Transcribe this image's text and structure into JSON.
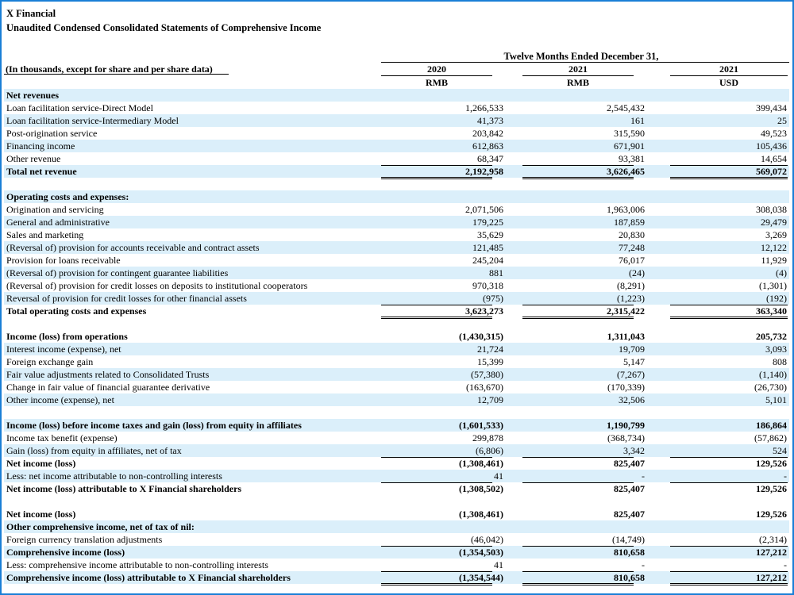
{
  "company": "X Financial",
  "statement_title": "Unaudited Condensed Consolidated Statements of Comprehensive Income",
  "period_header": "Twelve Months Ended December 31,",
  "units_note": "(In thousands, except for share and per share data)",
  "columns": [
    {
      "year": "2020",
      "currency": "RMB"
    },
    {
      "year": "2021",
      "currency": "RMB"
    },
    {
      "year": "2021",
      "currency": "USD"
    }
  ],
  "rows": [
    {
      "label": "Net revenues",
      "bold": true,
      "values": [
        "",
        "",
        ""
      ]
    },
    {
      "label": "Loan facilitation service-Direct Model",
      "values": [
        "1,266,533",
        "2,545,432",
        "399,434"
      ]
    },
    {
      "label": "Loan facilitation service-Intermediary Model",
      "values": [
        "41,373",
        "161",
        "25"
      ]
    },
    {
      "label": "Post-origination service",
      "values": [
        "203,842",
        "315,590",
        "49,523"
      ]
    },
    {
      "label": "Financing income",
      "values": [
        "612,863",
        "671,901",
        "105,436"
      ]
    },
    {
      "label": "Other revenue",
      "values": [
        "68,347",
        "93,381",
        "14,654"
      ]
    },
    {
      "label": "Total net revenue",
      "bold": true,
      "values": [
        "2,192,958",
        "3,626,465",
        "569,072"
      ]
    },
    {
      "label": "",
      "values": [
        "",
        "",
        ""
      ]
    },
    {
      "label": "Operating costs and expenses:",
      "bold": true,
      "values": [
        "",
        "",
        ""
      ]
    },
    {
      "label": "Origination and servicing",
      "values": [
        "2,071,506",
        "1,963,006",
        "308,038"
      ]
    },
    {
      "label": "General and administrative",
      "values": [
        "179,225",
        "187,859",
        "29,479"
      ]
    },
    {
      "label": "Sales and marketing",
      "values": [
        "35,629",
        "20,830",
        "3,269"
      ]
    },
    {
      "label": "(Reversal of) provision for accounts receivable and contract assets",
      "values": [
        "121,485",
        "77,248",
        "12,122"
      ]
    },
    {
      "label": "Provision for loans receivable",
      "values": [
        "245,204",
        "76,017",
        "11,929"
      ]
    },
    {
      "label": "(Reversal of) provision for contingent guarantee liabilities",
      "values": [
        "881",
        "(24)",
        "(4)"
      ]
    },
    {
      "label": "(Reversal of) provision for credit losses on deposits to institutional cooperators",
      "values": [
        "970,318",
        "(8,291)",
        "(1,301)"
      ]
    },
    {
      "label": "Reversal of provision for credit losses for other financial assets",
      "values": [
        "(975)",
        "(1,223)",
        "(192)"
      ]
    },
    {
      "label": "Total operating costs and expenses",
      "bold": true,
      "values": [
        "3,623,273",
        "2,315,422",
        "363,340"
      ]
    },
    {
      "label": "",
      "values": [
        "",
        "",
        ""
      ]
    },
    {
      "label": "Income (loss) from operations",
      "bold": true,
      "values": [
        "(1,430,315)",
        "1,311,043",
        "205,732"
      ]
    },
    {
      "label": "Interest income (expense), net",
      "values": [
        "21,724",
        "19,709",
        "3,093"
      ]
    },
    {
      "label": "Foreign exchange gain",
      "values": [
        "15,399",
        "5,147",
        "808"
      ]
    },
    {
      "label": "Fair value adjustments related to Consolidated Trusts",
      "values": [
        "(57,380)",
        "(7,267)",
        "(1,140)"
      ]
    },
    {
      "label": "Change in fair value of financial guarantee derivative",
      "values": [
        "(163,670)",
        "(170,339)",
        "(26,730)"
      ]
    },
    {
      "label": "Other income (expense), net",
      "values": [
        "12,709",
        "32,506",
        "5,101"
      ]
    },
    {
      "label": "",
      "values": [
        "",
        "",
        ""
      ]
    },
    {
      "label": "Income (loss) before income taxes and gain (loss) from equity in affiliates",
      "bold": true,
      "values": [
        "(1,601,533)",
        "1,190,799",
        "186,864"
      ]
    },
    {
      "label": "Income tax benefit (expense)",
      "values": [
        "299,878",
        "(368,734)",
        "(57,862)"
      ]
    },
    {
      "label": "Gain (loss) from equity in affiliates, net of tax",
      "values": [
        "(6,806)",
        "3,342",
        "524"
      ]
    },
    {
      "label": "Net income (loss)",
      "bold": true,
      "values": [
        "(1,308,461)",
        "825,407",
        "129,526"
      ]
    },
    {
      "label": "Less: net income attributable to non-controlling interests",
      "values": [
        "41",
        "-",
        "-"
      ]
    },
    {
      "label": "Net income (loss) attributable to X Financial shareholders",
      "bold": true,
      "values": [
        "(1,308,502)",
        "825,407",
        "129,526"
      ]
    },
    {
      "label": "",
      "values": [
        "",
        "",
        ""
      ]
    },
    {
      "label": "Net income (loss)",
      "bold": true,
      "values": [
        "(1,308,461)",
        "825,407",
        "129,526"
      ]
    },
    {
      "label": "Other comprehensive income, net of tax of nil:",
      "bold": true,
      "values": [
        "",
        "",
        ""
      ]
    },
    {
      "label": "Foreign currency translation adjustments",
      "values": [
        "(46,042)",
        "(14,749)",
        "(2,314)"
      ]
    },
    {
      "label": "Comprehensive income (loss)",
      "bold": true,
      "values": [
        "(1,354,503)",
        "810,658",
        "127,212"
      ]
    },
    {
      "label": "Less: comprehensive income attributable to non-controlling interests",
      "values": [
        "41",
        "-",
        "-"
      ]
    },
    {
      "label": "Comprehensive income (loss) attributable to X Financial shareholders",
      "bold": true,
      "values": [
        "(1,354,544)",
        "810,658",
        "127,212"
      ]
    }
  ]
}
